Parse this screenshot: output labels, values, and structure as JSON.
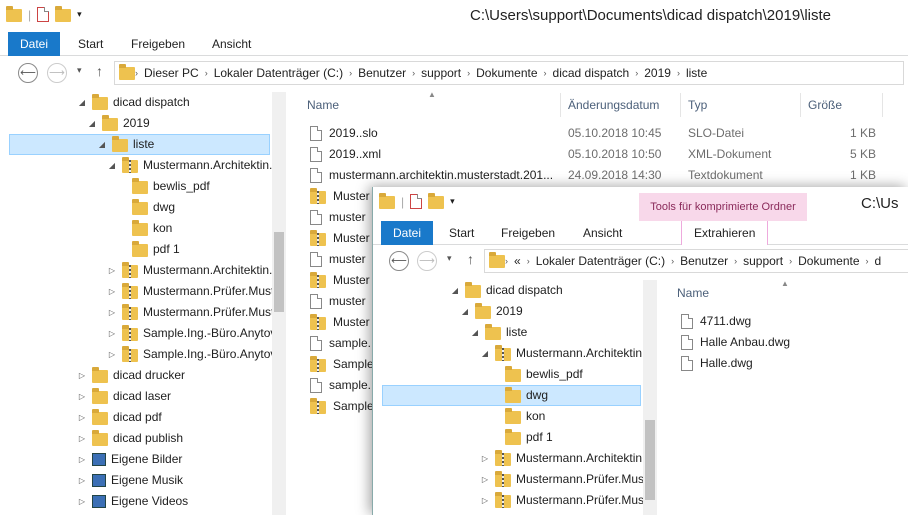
{
  "window1": {
    "title": "C:\\Users\\support\\Documents\\dicad dispatch\\2019\\liste",
    "ribbon_tabs": [
      "Datei",
      "Start",
      "Freigeben",
      "Ansicht"
    ],
    "breadcrumbs": [
      "Dieser PC",
      "Lokaler Datenträger (C:)",
      "Benutzer",
      "support",
      "Dokumente",
      "dicad dispatch",
      "2019",
      "liste"
    ],
    "tree": [
      {
        "label": "dicad dispatch",
        "indent": 4,
        "expander": "◢",
        "icon": "folder"
      },
      {
        "label": "2019",
        "indent": 5,
        "expander": "◢",
        "icon": "folder"
      },
      {
        "label": "liste",
        "indent": 6,
        "expander": "◢",
        "icon": "folder",
        "selected": true
      },
      {
        "label": "Mustermann.Architektin.",
        "indent": 7,
        "expander": "◢",
        "icon": "zip"
      },
      {
        "label": "bewlis_pdf",
        "indent": 8,
        "expander": "",
        "icon": "folder"
      },
      {
        "label": "dwg",
        "indent": 8,
        "expander": "",
        "icon": "folder"
      },
      {
        "label": "kon",
        "indent": 8,
        "expander": "",
        "icon": "folder"
      },
      {
        "label": "pdf 1",
        "indent": 8,
        "expander": "",
        "icon": "folder"
      },
      {
        "label": "Mustermann.Architektin.",
        "indent": 7,
        "expander": "▷",
        "icon": "zip"
      },
      {
        "label": "Mustermann.Prüfer.Must",
        "indent": 7,
        "expander": "▷",
        "icon": "zip"
      },
      {
        "label": "Mustermann.Prüfer.Must",
        "indent": 7,
        "expander": "▷",
        "icon": "zip"
      },
      {
        "label": "Sample.Ing.-Büro.Anytov",
        "indent": 7,
        "expander": "▷",
        "icon": "zip"
      },
      {
        "label": "Sample.Ing.-Büro.Anytov",
        "indent": 7,
        "expander": "▷",
        "icon": "zip"
      },
      {
        "label": "dicad drucker",
        "indent": 4,
        "expander": "▷",
        "icon": "folder"
      },
      {
        "label": "dicad laser",
        "indent": 4,
        "expander": "▷",
        "icon": "folder"
      },
      {
        "label": "dicad pdf",
        "indent": 4,
        "expander": "▷",
        "icon": "folder"
      },
      {
        "label": "dicad publish",
        "indent": 4,
        "expander": "▷",
        "icon": "folder"
      },
      {
        "label": "Eigene Bilder",
        "indent": 4,
        "expander": "▷",
        "icon": "image"
      },
      {
        "label": "Eigene Musik",
        "indent": 4,
        "expander": "▷",
        "icon": "image"
      },
      {
        "label": "Eigene Videos",
        "indent": 4,
        "expander": "▷",
        "icon": "image"
      }
    ],
    "columns": {
      "name": "Name",
      "date": "Änderungsdatum",
      "type": "Typ",
      "size": "Größe"
    },
    "files": [
      {
        "name": "2019..slo",
        "date": "05.10.2018 10:45",
        "type": "SLO-Datei",
        "size": "1 KB",
        "icon": "doc"
      },
      {
        "name": "2019..xml",
        "date": "05.10.2018 10:50",
        "type": "XML-Dokument",
        "size": "5 KB",
        "icon": "doc"
      },
      {
        "name": "mustermann.architektin.musterstadt.201...",
        "date": "24.09.2018 14:30",
        "type": "Textdokument",
        "size": "1 KB",
        "icon": "doc"
      },
      {
        "name": "Muster",
        "date": "",
        "type": "",
        "size": "",
        "icon": "zip"
      },
      {
        "name": "muster",
        "date": "",
        "type": "",
        "size": "",
        "icon": "doc"
      },
      {
        "name": "Muster",
        "date": "",
        "type": "",
        "size": "",
        "icon": "zip"
      },
      {
        "name": "muster",
        "date": "",
        "type": "",
        "size": "",
        "icon": "doc"
      },
      {
        "name": "Muster",
        "date": "",
        "type": "",
        "size": "",
        "icon": "zip"
      },
      {
        "name": "muster",
        "date": "",
        "type": "",
        "size": "",
        "icon": "doc"
      },
      {
        "name": "Muster",
        "date": "",
        "type": "",
        "size": "",
        "icon": "zip"
      },
      {
        "name": "sample.",
        "date": "",
        "type": "",
        "size": "",
        "icon": "doc"
      },
      {
        "name": "Sample.",
        "date": "",
        "type": "",
        "size": "",
        "icon": "zip"
      },
      {
        "name": "sample.",
        "date": "",
        "type": "",
        "size": "",
        "icon": "doc"
      },
      {
        "name": "Sample.",
        "date": "",
        "type": "",
        "size": "",
        "icon": "zip"
      }
    ]
  },
  "window2": {
    "title": "C:\\Us",
    "context_tab": "Tools für komprimierte Ordner",
    "ribbon_tabs": [
      "Datei",
      "Start",
      "Freigeben",
      "Ansicht",
      "Extrahieren"
    ],
    "breadcrumbs": [
      "«",
      "Lokaler Datenträger (C:)",
      "Benutzer",
      "support",
      "Dokumente",
      "d"
    ],
    "tree": [
      {
        "label": "dicad dispatch",
        "indent": 4,
        "expander": "◢",
        "icon": "folder"
      },
      {
        "label": "2019",
        "indent": 5,
        "expander": "◢",
        "icon": "folder"
      },
      {
        "label": "liste",
        "indent": 6,
        "expander": "◢",
        "icon": "folder"
      },
      {
        "label": "Mustermann.Architektin.",
        "indent": 7,
        "expander": "◢",
        "icon": "zip"
      },
      {
        "label": "bewlis_pdf",
        "indent": 8,
        "expander": "",
        "icon": "folder"
      },
      {
        "label": "dwg",
        "indent": 8,
        "expander": "",
        "icon": "folder",
        "selected": true
      },
      {
        "label": "kon",
        "indent": 8,
        "expander": "",
        "icon": "folder"
      },
      {
        "label": "pdf 1",
        "indent": 8,
        "expander": "",
        "icon": "folder"
      },
      {
        "label": "Mustermann.Architektin.",
        "indent": 7,
        "expander": "▷",
        "icon": "zip"
      },
      {
        "label": "Mustermann.Prüfer.Must",
        "indent": 7,
        "expander": "▷",
        "icon": "zip"
      },
      {
        "label": "Mustermann.Prüfer.Must",
        "indent": 7,
        "expander": "▷",
        "icon": "zip"
      }
    ],
    "column_name": "Name",
    "files": [
      {
        "name": "4711.dwg"
      },
      {
        "name": "Halle Anbau.dwg"
      },
      {
        "name": "Halle.dwg"
      }
    ]
  },
  "colors": {
    "accent": "#1979ca",
    "selection": "#cce8ff",
    "context_tab": "#f8d8ea"
  }
}
